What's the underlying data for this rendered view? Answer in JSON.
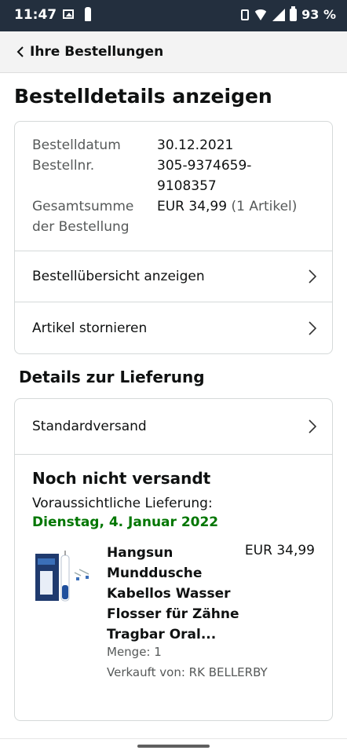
{
  "statusbar": {
    "time": "11:47",
    "battery": "93 %"
  },
  "nav": {
    "back_label": "Ihre Bestellungen"
  },
  "page_title": "Bestelldetails anzeigen",
  "order": {
    "date_label": "Bestelldatum",
    "date": "30.12.2021",
    "number_label": "Bestellnr.",
    "number_line1": "305-9374659-",
    "number_line2": "9108357",
    "total_label_line1": "Gesamtsumme",
    "total_label_line2": "der Bestellung",
    "total": "EUR 34,99",
    "total_count": "(1 Artikel)"
  },
  "actions": {
    "overview": "Bestellübersicht anzeigen",
    "cancel": "Artikel stornieren"
  },
  "delivery": {
    "section_title": "Details zur Lieferung",
    "shipping_method": "Standardversand",
    "status": "Noch nicht versandt",
    "expected_label": "Voraussichtliche Lieferung:",
    "expected_date": "Dienstag, 4. Januar 2022",
    "date_color": "#007600"
  },
  "item": {
    "name": "Hangsun Munddusche Kabellos Wasser Flosser für Zähne Tragbar Oral...",
    "price": "EUR 34,99",
    "quantity": "Menge: 1",
    "seller": "Verkauft von: RK BELLERBY"
  }
}
